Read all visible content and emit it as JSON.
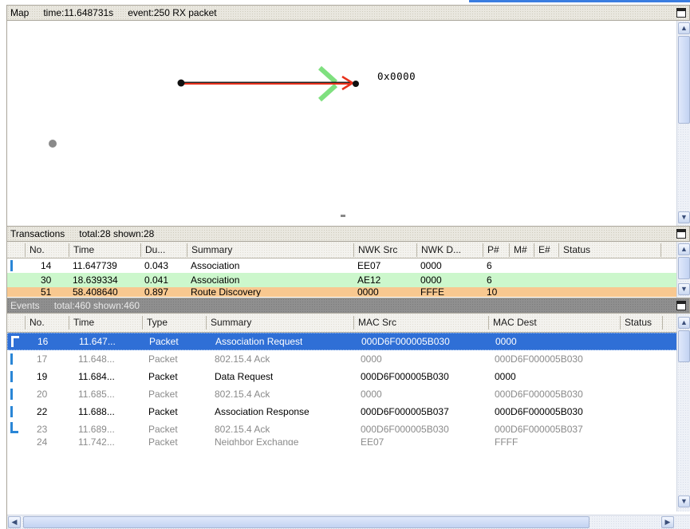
{
  "map_panel": {
    "title": "Map",
    "time": "time:11.648731s",
    "event": "event:250 RX packet",
    "node_label": "0x0000"
  },
  "transactions_panel": {
    "title": "Transactions",
    "total": "total:28 shown:28",
    "columns": [
      "No.",
      "Time",
      "Du...",
      "Summary",
      "NWK Src",
      "NWK D...",
      "P#",
      "M#",
      "E#",
      "Status"
    ],
    "rows": [
      {
        "no": "14",
        "time": "11.647739",
        "dur": "0.043",
        "summary": "Association",
        "src": "EE07",
        "dst": "0000",
        "p": "6",
        "m": "",
        "e": "",
        "status": ""
      },
      {
        "no": "30",
        "time": "18.639334",
        "dur": "0.041",
        "summary": "Association",
        "src": "AE12",
        "dst": "0000",
        "p": "6",
        "m": "",
        "e": "",
        "status": ""
      },
      {
        "no": "51",
        "time": "58.408640",
        "dur": "0.897",
        "summary": "Route Discovery",
        "src": "0000",
        "dst": "FFFE",
        "p": "10",
        "m": "",
        "e": "",
        "status": ""
      }
    ]
  },
  "events_panel": {
    "title": "Events",
    "total": "total:460 shown:460",
    "columns": [
      "No.",
      "Time",
      "Type",
      "Summary",
      "MAC Src",
      "MAC Dest",
      "Status"
    ],
    "rows": [
      {
        "no": "16",
        "time": "11.647...",
        "type": "Packet",
        "summary": "Association Request",
        "src": "000D6F000005B030",
        "dst": "0000",
        "status": ""
      },
      {
        "no": "17",
        "time": "11.648...",
        "type": "Packet",
        "summary": "802.15.4 Ack",
        "src": "0000",
        "dst": "000D6F000005B030",
        "status": ""
      },
      {
        "no": "19",
        "time": "11.684...",
        "type": "Packet",
        "summary": "Data Request",
        "src": "000D6F000005B030",
        "dst": "0000",
        "status": ""
      },
      {
        "no": "20",
        "time": "11.685...",
        "type": "Packet",
        "summary": "802.15.4 Ack",
        "src": "0000",
        "dst": "000D6F000005B030",
        "status": ""
      },
      {
        "no": "22",
        "time": "11.688...",
        "type": "Packet",
        "summary": "Association Response",
        "src": "000D6F000005B037",
        "dst": "000D6F000005B030",
        "status": ""
      },
      {
        "no": "23",
        "time": "11.689...",
        "type": "Packet",
        "summary": "802.15.4 Ack",
        "src": "000D6F000005B030",
        "dst": "000D6F000005B037",
        "status": ""
      },
      {
        "no": "24",
        "time": "11.742...",
        "type": "Packet",
        "summary": "Neighbor Exchange",
        "src": "EE07",
        "dst": "FFFF",
        "status": ""
      }
    ]
  },
  "colors": {
    "selection": "#2f6fd6",
    "transaction_green": "#ccf7cc",
    "transaction_orange": "#f8c890",
    "arrow_red": "#e8311c",
    "arrow_green": "#7fe07f",
    "marker_blue": "#2a86d6"
  }
}
